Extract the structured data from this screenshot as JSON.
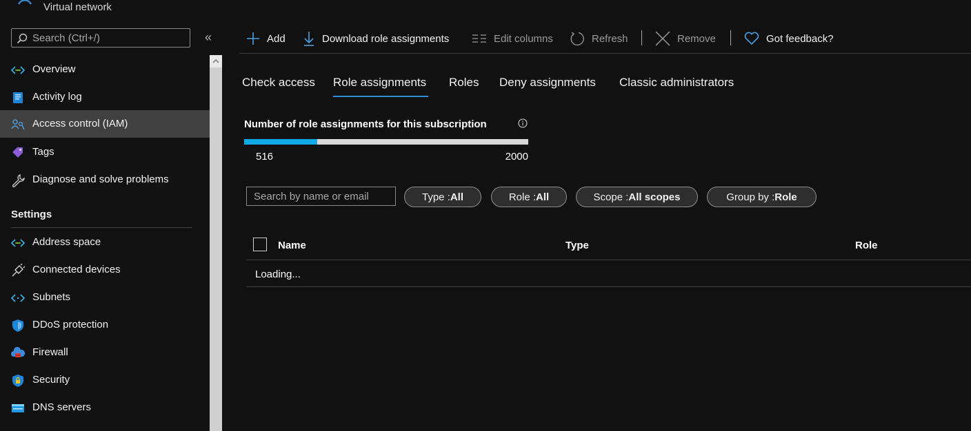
{
  "header": {
    "title": "Virtual network"
  },
  "sidebar": {
    "search_placeholder": "Search (Ctrl+/)",
    "collapse_glyph": "«",
    "items": [
      {
        "label": "Overview",
        "icon": "overview-icon"
      },
      {
        "label": "Activity log",
        "icon": "activity-log-icon"
      },
      {
        "label": "Access control (IAM)",
        "icon": "iam-icon",
        "active": true
      },
      {
        "label": "Tags",
        "icon": "tag-icon"
      },
      {
        "label": "Diagnose and solve problems",
        "icon": "wrench-icon"
      }
    ],
    "settings_heading": "Settings",
    "settings_items": [
      {
        "label": "Address space",
        "icon": "address-space-icon"
      },
      {
        "label": "Connected devices",
        "icon": "plug-icon"
      },
      {
        "label": "Subnets",
        "icon": "subnets-icon"
      },
      {
        "label": "DDoS protection",
        "icon": "shield-icon"
      },
      {
        "label": "Firewall",
        "icon": "firewall-icon"
      },
      {
        "label": "Security",
        "icon": "security-icon"
      },
      {
        "label": "DNS servers",
        "icon": "dns-icon"
      }
    ]
  },
  "toolbar": {
    "add": "Add",
    "download": "Download role assignments",
    "edit_columns": "Edit columns",
    "refresh": "Refresh",
    "remove": "Remove",
    "feedback": "Got feedback?"
  },
  "tabs": [
    "Check access",
    "Role assignments",
    "Roles",
    "Deny assignments",
    "Classic administrators"
  ],
  "active_tab": "Role assignments",
  "metric": {
    "title": "Number of role assignments for this subscription",
    "current": "516",
    "max": "2000",
    "fraction": 0.258
  },
  "filters": {
    "search_placeholder": "Search by name or email",
    "type": {
      "label": "Type : ",
      "value": "All"
    },
    "role": {
      "label": "Role : ",
      "value": "All"
    },
    "scope": {
      "label": "Scope : ",
      "value": "All scopes"
    },
    "group": {
      "label": "Group by : ",
      "value": "Role"
    }
  },
  "table": {
    "columns": [
      "Name",
      "Type",
      "Role"
    ],
    "status": "Loading..."
  },
  "colors": {
    "accent": "#2f8fd7",
    "bar_fill": "#10a9e6",
    "bar_track": "#d8d8d8",
    "background": "#111111",
    "active_nav": "#404040"
  }
}
